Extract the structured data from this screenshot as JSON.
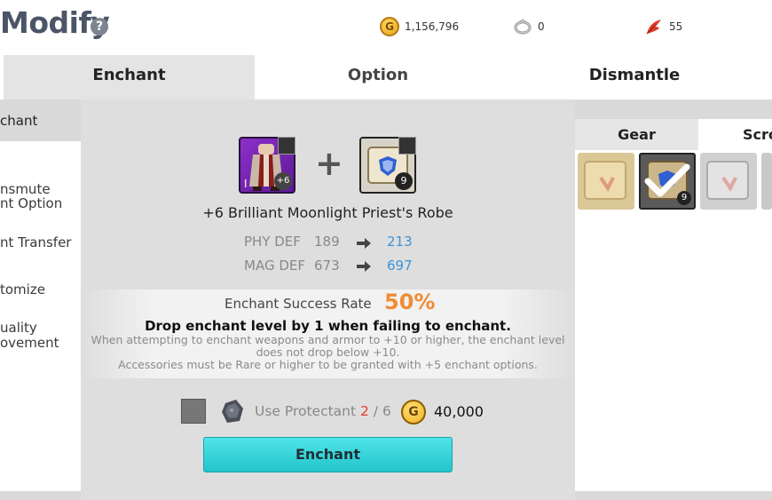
{
  "header": {
    "title": "Modify",
    "help": "?",
    "gold": "1,156,796",
    "ring_count": "0",
    "feather_count": "55"
  },
  "tabs": [
    {
      "label": "Enchant"
    },
    {
      "label": "Option"
    },
    {
      "label": "Dismantle"
    }
  ],
  "sidebar": {
    "items": [
      {
        "label": "chant"
      },
      {
        "label": "nsmute"
      },
      {
        "label": "nt Option"
      },
      {
        "label": "nt Transfer"
      },
      {
        "label": "tomize"
      },
      {
        "label": "uality"
      },
      {
        "label": "ovement"
      }
    ]
  },
  "item": {
    "name": "+6 Brilliant Moonlight Priest's Robe",
    "robe_level": "+6",
    "robe_grade": "I",
    "scroll_count": "9"
  },
  "stats": [
    {
      "label": "PHY DEF",
      "current": "189",
      "next": "213"
    },
    {
      "label": "MAG DEF",
      "current": "673",
      "next": "697"
    }
  ],
  "rate": {
    "label": "Enchant Success Rate",
    "value": "50%",
    "desc": "Drop enchant level by 1 when failing to enchant.",
    "note1": "When attempting to enchant weapons and armor to +10 or higher, the enchant level",
    "note2": "does not drop below +10.",
    "note3": "Accessories must be Rare or higher to be granted with +5 enchant options."
  },
  "protectant": {
    "label": "Use Protectant",
    "current": "2",
    "sep": " / ",
    "max": "6",
    "coin": "G",
    "cost": "40,000"
  },
  "enchant_button": "Enchant",
  "right_panel": {
    "tab_gear": "Gear",
    "tab_scroll": "Scro",
    "selected_slot_count": "9"
  },
  "colors": {
    "accent_button": "#22c5cc",
    "rate_value": "#f08c35",
    "stat_new": "#3b93d8",
    "protect_current": "#e23b2b"
  }
}
